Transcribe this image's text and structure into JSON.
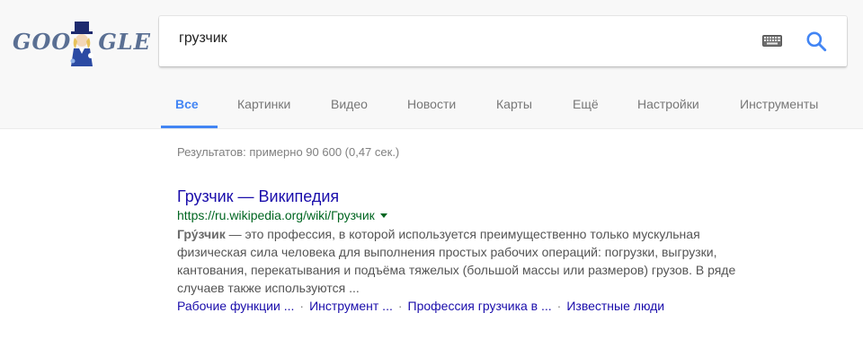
{
  "logo": {
    "text_left": "GOO",
    "text_right": "GLE"
  },
  "search": {
    "query": "грузчик",
    "keyboard_icon": "keyboard-icon",
    "search_icon": "search-icon"
  },
  "tabs": [
    {
      "label": "Все",
      "active": true
    },
    {
      "label": "Картинки"
    },
    {
      "label": "Видео"
    },
    {
      "label": "Новости"
    },
    {
      "label": "Карты"
    },
    {
      "label": "Ещё"
    },
    {
      "label": "Настройки"
    },
    {
      "label": "Инструменты"
    }
  ],
  "stats": "Результатов: примерно 90 600 (0,47 сек.)",
  "result": {
    "title": "Грузчик — Википедия",
    "url": "https://ru.wikipedia.org/wiki/Грузчик",
    "snippet_bold": "Гру́зчик",
    "snippet_line1": " — это профессия, в которой используется преимущественно только мускульная",
    "snippet_line2": "физическая сила человека для выполнения простых рабочих операций: погрузки, выгрузки,",
    "snippet_line3": "кантования, перекатывания и подъёма тяжелых (большой массы или размеров) грузов. В ряде",
    "snippet_line4": "случаев также используются ...",
    "sitelinks": [
      "Рабочие функции ...",
      "Инструмент ...",
      "Профессия грузчика в ...",
      "Известные люди"
    ],
    "sitelink_separator": "·"
  },
  "colors": {
    "link": "#1a0dab",
    "url": "#006621",
    "active_tab": "#4285f4",
    "snippet": "#545454"
  }
}
